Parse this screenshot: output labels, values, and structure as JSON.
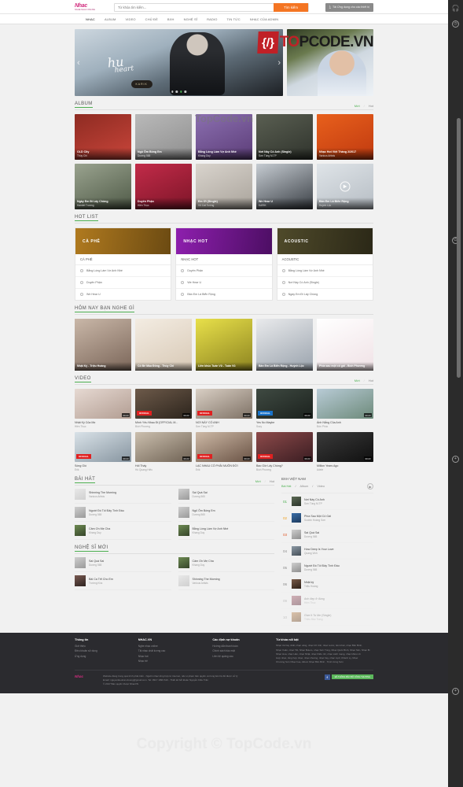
{
  "header": {
    "logo_main": "Nhac",
    "logo_sub": "NGHE NHAC ONLINE",
    "search_placeholder": "Từ khóa tìm kiếm...",
    "search_value": "",
    "search_button": "Tìm kiếm",
    "app_button": "Tải Ứng dụng cho các thiết bị",
    "nav": [
      {
        "label": "NHẠC",
        "active": true
      },
      {
        "label": "ALBUM",
        "active": false
      },
      {
        "label": "VIDEO",
        "active": false
      },
      {
        "label": "CHỦ ĐỀ",
        "active": false
      },
      {
        "label": "BXH",
        "active": false
      },
      {
        "label": "NGHỆ SĨ",
        "active": false
      },
      {
        "label": "RADIO",
        "active": false
      },
      {
        "label": "TIN TỨC",
        "active": false
      },
      {
        "label": "NHẠC CỦA ADMIN",
        "active": false
      }
    ]
  },
  "brand_overlay": {
    "mark": "{/}",
    "text_red": "TO",
    "text_dark": "PCODE.VN"
  },
  "watermark": {
    "hero": "TopCode.vn",
    "footer": "Copyright © TopCode.vn"
  },
  "hero": {
    "script_line1": "hu",
    "script_line2": "heart",
    "badge": "KARIK",
    "prev": "‹",
    "next": "›",
    "dots": 4,
    "active_dot": 2
  },
  "album": {
    "title": "ALBUM",
    "tab_new": "Mới",
    "tab_hot": "Hot",
    "items": [
      {
        "title": "OLD City",
        "artist": "Thùy Chi",
        "c1": "#8e2b22",
        "c2": "#c8453a"
      },
      {
        "title": "Ngủ Ôm Bóng Em",
        "artist": "Dương 565",
        "c1": "#b9b9b9",
        "c2": "#8e8e8e"
      },
      {
        "title": "Bằng Lòng Làm Vợ Anh Nhé",
        "artist": "Khang Duy",
        "c1": "#8b6fb0",
        "c2": "#5c3d78"
      },
      {
        "title": "Nơi Này Có Anh (Single)",
        "artist": "Sơn Tùng M-TP",
        "c1": "#5a5f52",
        "c2": "#2f332c"
      },
      {
        "title": "Nhạc Hot Việt Tháng 2/2017",
        "artist": "Various Artists",
        "c1": "#e8601c",
        "c2": "#c03a10"
      },
      {
        "title": "Ngày Em Đi Lấy Chồng",
        "artist": "Hamlet Trương",
        "c1": "#9aa38f",
        "c2": "#4f5a47"
      },
      {
        "title": "Duyên Phận",
        "artist": "Hiền Thục",
        "c1": "#c22b49",
        "c2": "#7d1528"
      },
      {
        "title": "Em Ơi (Single)",
        "artist": "Võ Cát Tường",
        "c1": "#d9d4cd",
        "c2": "#a9a39b"
      },
      {
        "title": "We Hear U",
        "artist": "KARIK",
        "c1": "#c6ccd2",
        "c2": "#3a3f45"
      },
      {
        "title": "Bản Em Là Biển Rộng",
        "artist": "Huỳnh Lộc",
        "c1": "#dfe4e8",
        "c2": "#b6bdc4",
        "play": true
      }
    ]
  },
  "hotlist": {
    "title": "HOT LIST",
    "cards": [
      {
        "banner": "CÀ PHÊ",
        "banner_c1": "#b07a1f",
        "banner_c2": "#6b4a12",
        "sub": "CÀ PHÊ",
        "songs": [
          "Bằng Lòng Làm Vợ Anh Nhé",
          "Duyên Phận",
          "We Hear U"
        ]
      },
      {
        "banner": "NHẠC HOT",
        "banner_c1": "#8e1fae",
        "banner_c2": "#4c0e63",
        "sub": "NHẠC HOT",
        "songs": [
          "Duyên Phận",
          "We Hear U",
          "Bản Em Là Biển Rộng"
        ]
      },
      {
        "banner": "ACOUSTIC",
        "banner_c1": "#4f4a2a",
        "banner_c2": "#2b2817",
        "sub": "ACOUSTIC",
        "songs": [
          "Bằng Lòng Làm Vợ Anh Nhé",
          "Nơi Này Có Anh (Single)",
          "Ngày Em Đi Lấy Chồng"
        ]
      }
    ]
  },
  "today": {
    "title": "HÔM NAY BẠN NGHE GÌ",
    "items": [
      {
        "title": "Nhật Ký - Triệu Hoàng",
        "c1": "#c9b7a8",
        "c2": "#7b6659"
      },
      {
        "title": "Cô Bé Mùa Đông - Thùy Chi",
        "c1": "#f3ece2",
        "c2": "#d8c9b6"
      },
      {
        "title": "Liên khúc Tuấn Vũ - Tuấn Vũ",
        "c1": "#e8e04a",
        "c2": "#8d8420"
      },
      {
        "title": "Bản Em Là Biển Rộng - Huỳnh Lộc",
        "c1": "#e9eaec",
        "c2": "#9aa3ad"
      },
      {
        "title": "Phía sau một cô gái - Bích Phương",
        "c1": "#ffffff",
        "c2": "#f0e2e6"
      }
    ]
  },
  "video": {
    "title": "VIDEO",
    "tab_new": "Mới",
    "tab_hot": "Hot",
    "items": [
      {
        "title": "Nhật Ký Của Mẹ",
        "artist": "Hiền Thục",
        "dur": "00:23",
        "c1": "#e6d9d2",
        "c2": "#b29d92",
        "tag": ""
      },
      {
        "title": "Mình Yêu Nhau Đi [OFFICIAL M...",
        "artist": "Bích Phương",
        "dur": "00:23",
        "c1": "#6d5a4a",
        "c2": "#2c241c",
        "tag": "OFFICIAL"
      },
      {
        "title": "NƠI NÀY CÓ ANH",
        "artist": "Sơn Tùng M-TP",
        "dur": "00:23",
        "c1": "#d9cfc4",
        "c2": "#7e7165",
        "tag": "OFFICIAL"
      },
      {
        "title": "Yes No Maybe",
        "artist": "Suzy",
        "dur": "00:23",
        "c1": "#3f4a42",
        "c2": "#1b211d",
        "tag": "OFFICIAL",
        "tag_blue": true
      },
      {
        "title": "Ánh Nắng Của Anh",
        "artist": "Đức Phúc",
        "dur": "00:23",
        "c1": "#b8cbd6",
        "c2": "#6d8a7a",
        "tag": ""
      },
      {
        "title": "Sóng Gió",
        "artist": "Erik",
        "dur": "00:23",
        "c1": "#d9e2e8",
        "c2": "#8795a0",
        "tag": "OFFICIAL"
      },
      {
        "title": "Hối Thấy",
        "artist": "Hồ Quang Hiếu",
        "dur": "00:23",
        "c1": "#cbbfae",
        "c2": "#6f6254",
        "tag": ""
      },
      {
        "title": "LẠC NHAU CÓ PHẢI MUÔN ĐỜI",
        "artist": "Erik",
        "dur": "00:23",
        "c1": "#cdb9a6",
        "c2": "#6a5345",
        "tag": "OFFICIAL"
      },
      {
        "title": "Bao Giờ Lấy Chồng?",
        "artist": "Bích Phương",
        "dur": "00:23",
        "c1": "#8d4a4a",
        "c2": "#3a1d22",
        "tag": "OFFICIAL"
      },
      {
        "title": "Million Years Ago",
        "artist": "Adele",
        "dur": "00:23",
        "c1": "#3a3a3a",
        "c2": "#101010",
        "tag": ""
      }
    ]
  },
  "songs": {
    "title": "BÀI HÁT",
    "tab_new": "Mới",
    "tab_hot": "Hot",
    "items": [
      {
        "title": "Shinning The Morning",
        "artist": "Various Artists",
        "c1": "#e8e8e8",
        "c2": "#d0d0d0"
      },
      {
        "title": "Sai Quá Sai",
        "artist": "Dương 565",
        "c1": "#cfcfcf",
        "c2": "#9a9a9a"
      },
      {
        "title": "Người Đó Tôi Đây Tình Đầu",
        "artist": "Dương 565",
        "c1": "#cfcfcf",
        "c2": "#9a9a9a"
      },
      {
        "title": "Ngủ Ôm Bóng Em",
        "artist": "Dương 565",
        "c1": "#cfcfcf",
        "c2": "#9a9a9a"
      },
      {
        "title": "Cảm Ơn Mẹ Cha",
        "artist": "Khang Duy",
        "c1": "#6d8a52",
        "c2": "#36452a"
      },
      {
        "title": "Bằng Lòng Làm Vợ Anh Nhé",
        "artist": "Khang Duy",
        "c1": "#6d8a52",
        "c2": "#36452a"
      }
    ]
  },
  "artists": {
    "title": "NGHỆ SĨ MỚI",
    "items": [
      {
        "title": "Sai Quá Sai",
        "artist": "Dương 565",
        "c1": "#cfcfcf",
        "c2": "#9a9a9a"
      },
      {
        "title": "Cảm Ơn Mẹ Cha",
        "artist": "Khang Duy",
        "c1": "#6d8a52",
        "c2": "#36452a"
      },
      {
        "title": "Bài Ca Tết Cho Em",
        "artist": "Trường Kha",
        "c1": "#7a5a52",
        "c2": "#2d2320"
      },
      {
        "title": "Shinning The Morning",
        "artist": "Various Artists",
        "c1": "#e8e8e8",
        "c2": "#d0d0d0"
      }
    ]
  },
  "bxh": {
    "title": "BXH VIỆT NAM",
    "tabs": [
      {
        "label": "Bài Hát",
        "active": true
      },
      {
        "label": "Album",
        "active": false
      },
      {
        "label": "Video",
        "active": false
      }
    ],
    "rows": [
      {
        "no": "01",
        "title": "Nơi Này Có Anh",
        "artist": "Sơn Tùng M-TP",
        "c1": "#5d6b55",
        "c2": "#2b332a"
      },
      {
        "no": "02",
        "title": "Phía Sau Một Cô Gái",
        "artist": "Soobin Hoàng Sơn",
        "c1": "#3a6ea8",
        "c2": "#1d3a5c"
      },
      {
        "no": "03",
        "title": "Sai Quá Sai",
        "artist": "Dương 565",
        "c1": "#cfcfcf",
        "c2": "#8f8f8f"
      },
      {
        "no": "04",
        "title": "How Deep Is Your Love",
        "artist": "Quang Vinh",
        "c1": "#8d9aa5",
        "c2": "#444e57"
      },
      {
        "no": "05",
        "title": "Người Đó Tôi Đây Tình Đầu",
        "artist": "Dương 565",
        "c1": "#cfcfcf",
        "c2": "#8f8f8f"
      },
      {
        "no": "06",
        "title": "Nhật ký",
        "artist": "Triệu Hoàng",
        "c1": "#7a5c4a",
        "c2": "#2e2118"
      },
      {
        "no": "09",
        "title": "Anh đẹp ở đúng",
        "artist": "Hiền Thục",
        "c1": "#a8606e",
        "c2": "#5a2936"
      },
      {
        "no": "10",
        "title": "Give It To Me (Single)",
        "artist": "Thiều Bảo Trang",
        "c1": "#c08a56",
        "c2": "#6a4423"
      }
    ]
  },
  "footer": {
    "columns": [
      {
        "head": "Thông tin",
        "items": [
          "Giới thiệu",
          "Điều khoản sử dụng",
          "Ứng dụng"
        ]
      },
      {
        "head": "NHAC.VN",
        "items": [
          "Nghe nhạc online",
          "Tải nhạc chất lượng cao",
          "Nhạc hot",
          "Nhạc trẻ"
        ]
      },
      {
        "head": "Các định nợ khoản",
        "items": [
          "Hướng dẫn thanh toán",
          "Chính sách bảo mật",
          "Liên hệ quảng cáo"
        ]
      },
      {
        "head": "Từ khóa nổi bật",
        "items": [
          "Nhạc trẻ hay nhất, nhạc vàng, nhạc trữ tình, nhạc remix, liên khúc, nhạc Bốn Binh,",
          "Nhạc Xuân, nhạc Tết, Nhạc Bolero, nhạc Sơn Tùng, Nhạc Quốc Bình, Nhạc Sến, Nhạc Bi",
          "Nhạc Hoa, nhạc Hàn, nhạc Nhật, nhạc thiếu nhi, nhạc cách mạng, nhạc khiêu vũ",
          "Hợp nhạc, tổng hợp nhạc, nhạc chuông, nhạc hay, nhạc mp3, Khánh Ly, Nhạc",
          "Khương Sơn Nhạc hoa, Album Nhạc Bốn Binh , Trịnh Công Sơn"
        ]
      }
    ],
    "logo": "Nhac",
    "desc_line1": "Website đang trong quá trình phát triển - Nguồn nhạc tổng hợp từ internet, nếu vi phạm bản quyền vui lòng liên hệ để được xử lý",
    "desc_line2": "Email: nguyenkieutran.duong@gmail.com. Tel: 0917 1996 610 - Thiết kế bởi Đoàn Nguyễn Kiều Trân",
    "desc_line3": "© 2017 Bản quyền thuộc NhacVN",
    "cert_badge": "f",
    "cert_label": "ĐÃ THÔNG BÁO BỘ CÔNG THƯƠNG"
  },
  "rail": {
    "icons": [
      "headphones-icon",
      "clock-icon",
      "power-icon",
      "plus-icon",
      "plus-icon"
    ]
  }
}
